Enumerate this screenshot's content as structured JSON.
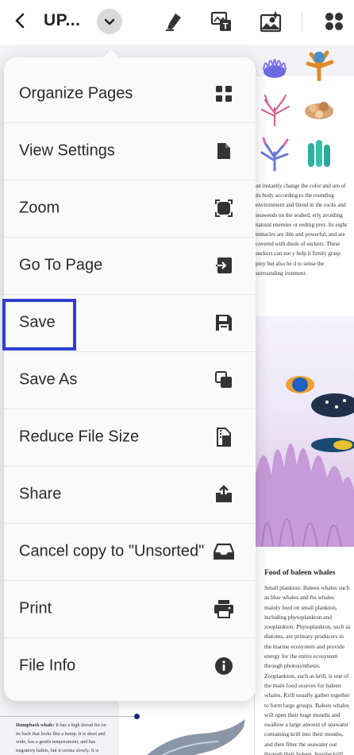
{
  "topbar": {
    "title": "UP...",
    "icons": [
      "back-icon",
      "chevron-down-icon",
      "highlighter-icon",
      "text-image-icon",
      "image-edit-icon",
      "apps-icon"
    ]
  },
  "menu": {
    "items": [
      {
        "label": "Organize Pages",
        "icon": "grid-icon"
      },
      {
        "label": "View Settings",
        "icon": "file-icon"
      },
      {
        "label": "Zoom",
        "icon": "zoom-frame-icon"
      },
      {
        "label": "Go To Page",
        "icon": "go-to-page-icon"
      },
      {
        "label": "Save",
        "icon": "save-icon"
      },
      {
        "label": "Save As",
        "icon": "copy-icon"
      },
      {
        "label": "Reduce File Size",
        "icon": "compress-icon"
      },
      {
        "label": "Share",
        "icon": "share-icon"
      },
      {
        "label": "Cancel copy to \"Unsorted\"",
        "icon": "inbox-icon"
      },
      {
        "label": "Print",
        "icon": "print-icon"
      },
      {
        "label": "File Info",
        "icon": "info-icon"
      }
    ]
  },
  "document": {
    "body_text": "an instantly change the color and ure of its body according to the rounding environment and blend in the rocks and seaweeds on the seabed, erly avoiding natural enemies or eeding prey. Its eight tentacles are ible and powerful, and are covered with dreds of suckers. These suckers can not y help it firmly grasp prey but also be d to sense the surrounding ironment.",
    "food_title": "Food of baleen whales",
    "food_text": "Small plankton: Baleen whales such as blue whales and fin whales mainly feed on small plankton, including phytoplankton and zooplankton. Phytoplankton, such as diatoms, are primary producers in the marine ecosystem and provide energy for the entire ecosystem through photosynthesis. Zooplankton, such as krill, is one of the main food sources for baleen whales. Krill usually gather together to form large groups. Baleen whales will open their huge mouths and swallow a large amount of seawater containing krill into their mouths, and then filter the seawater out through their baleen, leaving krill and other food in their mouths and",
    "humpback_label": "Humpback whale:",
    "humpback_text": "It has a high dorsal fin on its back that looks like a hump. It is short and wide, has a gentle temperament, and has migratory habits, but it swims slowly. It is often hunted in"
  },
  "colors": {
    "highlight": "#2d3fd0",
    "menu_bg": "#fafafa",
    "icon": "#333333"
  }
}
